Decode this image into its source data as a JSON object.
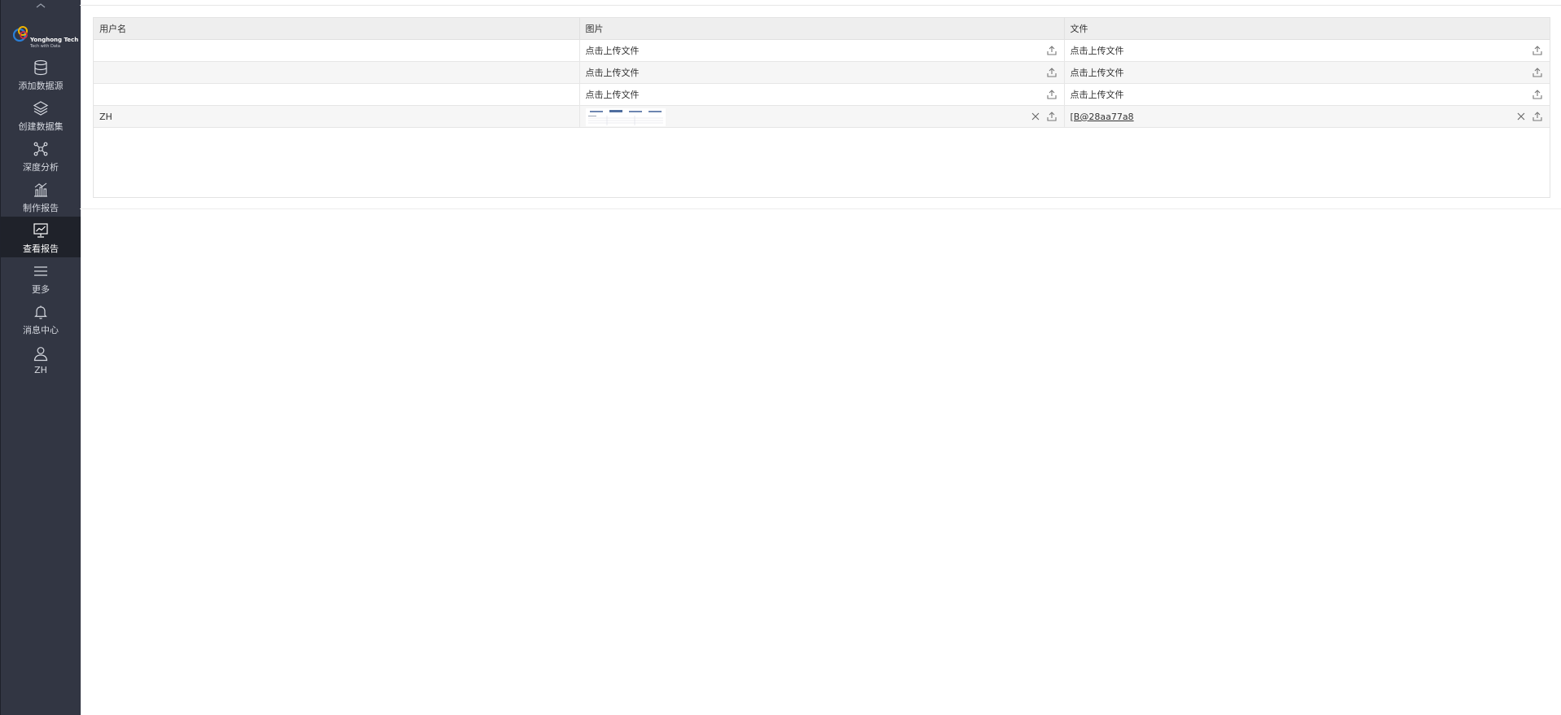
{
  "sidebar": {
    "logo": {
      "brand": "Yonghong Tech",
      "tagline": "Tech with Data"
    },
    "items": [
      {
        "label": "添加数据源",
        "icon": "database-icon",
        "active": false
      },
      {
        "label": "创建数据集",
        "icon": "layers-icon",
        "active": false
      },
      {
        "label": "深度分析",
        "icon": "network-icon",
        "active": false
      },
      {
        "label": "制作报告",
        "icon": "bar-chart-icon",
        "active": false
      },
      {
        "label": "查看报告",
        "icon": "monitor-chart-icon",
        "active": true
      },
      {
        "label": "更多",
        "icon": "menu-icon",
        "active": false
      },
      {
        "label": "消息中心",
        "icon": "bell-icon",
        "active": false
      },
      {
        "label": "ZH",
        "icon": "user-icon",
        "active": false
      }
    ]
  },
  "table": {
    "headers": [
      "用户名",
      "图片",
      "文件"
    ],
    "rows": [
      {
        "username": "",
        "image": "点击上传文件",
        "file": "点击上传文件"
      },
      {
        "username": "",
        "image": "点击上传文件",
        "file": "点击上传文件"
      },
      {
        "username": "",
        "image": "点击上传文件",
        "file": "点击上传文件"
      },
      {
        "username": "ZH",
        "image": "",
        "file": "[B@28aa77a8"
      }
    ]
  },
  "colors": {
    "sidebar_bg": "#323643",
    "sidebar_active": "#1f222a",
    "header_bg": "#eeeeee"
  }
}
